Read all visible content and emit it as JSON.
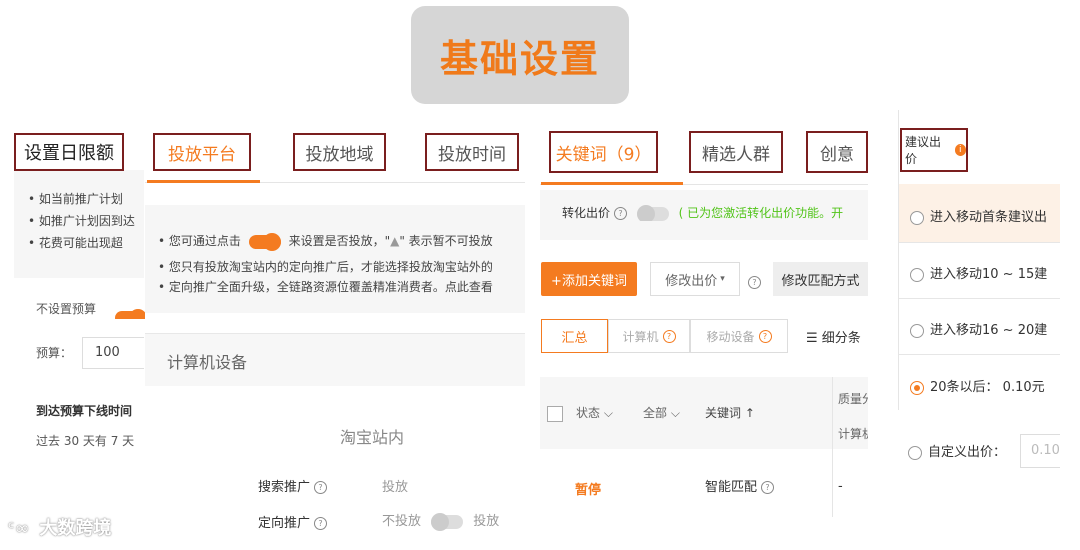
{
  "header": {
    "title": "基础设置"
  },
  "panel1": {
    "tab": "设置日限额",
    "bullets": [
      "如当前推广计划",
      "如推广计划因到达",
      "花费可能出现超"
    ],
    "no_budget_label": "不设置预算",
    "budget_label": "预算：",
    "budget_value": "100",
    "offline_label": "到达预算下线时间",
    "history_text": "过去 30 天有 7 天"
  },
  "panel2": {
    "tabs": [
      "投放平台",
      "投放地域",
      "投放时间"
    ],
    "info1_a": "您可通过点击",
    "info1_b": "来设置是否投放，\"",
    "info1_c": "\" 表示暂不可投放",
    "info2": "您只有投放淘宝站内的定向推广后，才能选择投放淘宝站外的",
    "info3": "定向推广全面升级，全链路资源位覆盖精准消费者。点此查看",
    "device_header": "计算机设备",
    "site_label": "淘宝站内",
    "rows": [
      {
        "name": "搜索推广",
        "value": "投放"
      },
      {
        "name": "定向推广",
        "value_off": "不投放",
        "value_on": "投放"
      }
    ]
  },
  "panel3": {
    "tabs": [
      "关键词（9）",
      "精选人群",
      "创意"
    ],
    "conversion_label": "转化出价",
    "conversion_note": "( 已为您激活转化出价功能。开",
    "add_keyword": "+添加关键词",
    "modify_bid": "修改出价",
    "modify_match": "修改匹配方式",
    "view_tabs": [
      "汇总",
      "计算机",
      "移动设备"
    ],
    "detail_label": "细分条",
    "cols": {
      "status": "状态",
      "all": "全部",
      "keyword": "关键词 ↑",
      "quality": "质量分",
      "computer": "计算机"
    },
    "row": {
      "status": "暂停",
      "match": "智能匹配",
      "dash": "-"
    }
  },
  "panel4": {
    "header": "建议出价",
    "options": [
      "进入移动首条建议出",
      "进入移动10 ~ 15建",
      "进入移动16 ~ 20建",
      "20条以后：  0.10元"
    ],
    "custom_label": "自定义出价：",
    "custom_placeholder": "0.10"
  },
  "watermark": {
    "text": "大数跨境"
  }
}
